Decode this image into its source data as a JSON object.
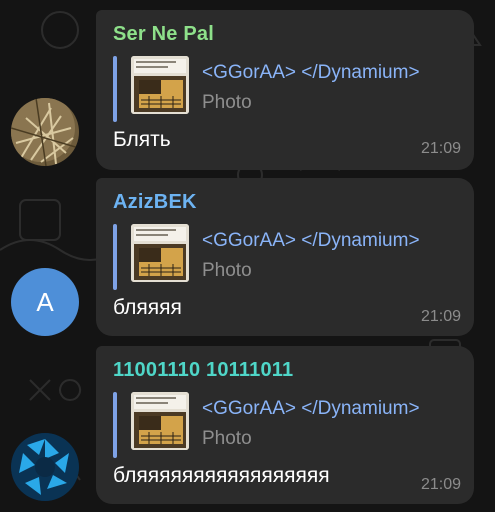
{
  "chat": {
    "messages": [
      {
        "sender": "Ser Ne Pal",
        "sender_color": "#8ee08a",
        "avatar_kind": "photo",
        "avatar_letter": "",
        "reply_author": "<GGorAA> </Dynamium>",
        "reply_kind": "Photo",
        "text": "Блять",
        "time": "21:09"
      },
      {
        "sender": "AzizBEK",
        "sender_color": "#6db3f2",
        "avatar_kind": "letter",
        "avatar_letter": "A",
        "reply_author": "<GGorAA> </Dynamium>",
        "reply_kind": "Photo",
        "text": "бляяяя",
        "time": "21:09"
      },
      {
        "sender": "11001110 10111011",
        "sender_color": "#4fd6c8",
        "avatar_kind": "aperture",
        "avatar_letter": "",
        "reply_author": "<GGorAA> </Dynamium>",
        "reply_kind": "Photo",
        "text": "бляяяяяяяяяяяяяяяяя",
        "time": "21:09"
      }
    ]
  },
  "colors": {
    "background": "#141414",
    "bubble": "#2b2b2b",
    "reply_accent": "#7ea2e6",
    "reply_author": "#8ab4f8",
    "letter_avatar": "#4e8fd8"
  }
}
